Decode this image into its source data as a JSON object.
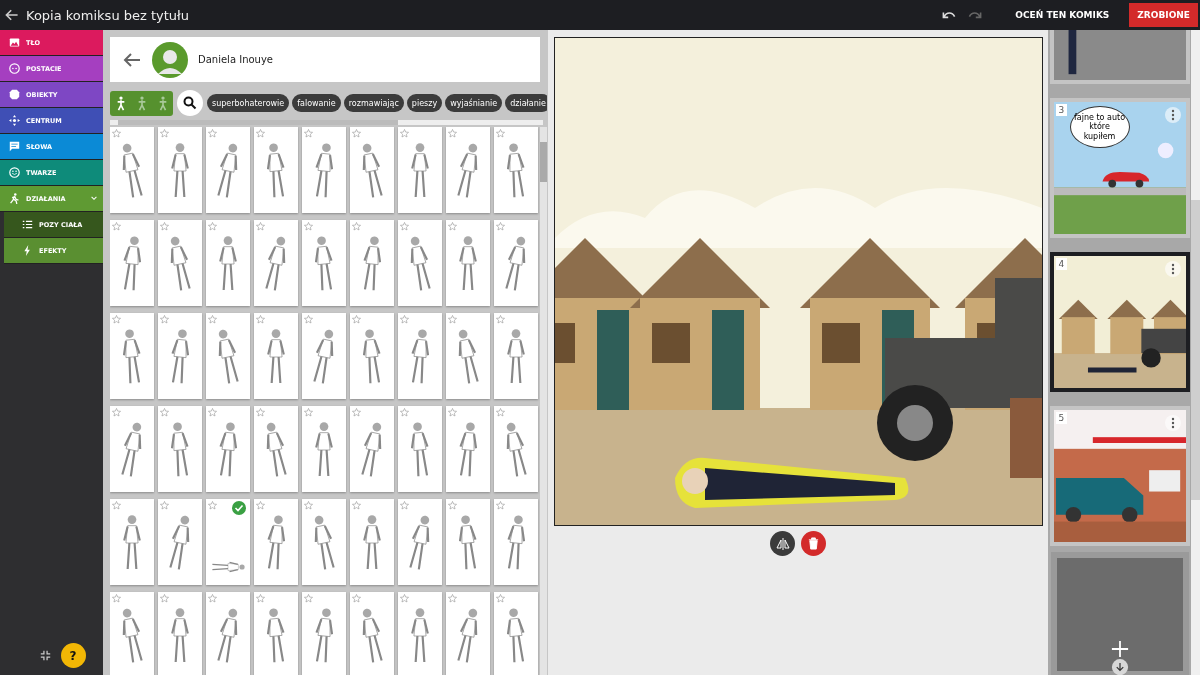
{
  "window": {
    "title": "Kopia komiksu bez tytułu"
  },
  "toolbar": {
    "rate_button": "OCEŃ TEN KOMIKS",
    "done_button": "ZROBIONE"
  },
  "sidebar": {
    "items": [
      {
        "label": "TŁO",
        "kind": "background",
        "color": "#dc1a5e",
        "expanded": false
      },
      {
        "label": "POSTACIE",
        "kind": "characters",
        "color": "#a53fc0",
        "expanded": false
      },
      {
        "label": "OBIEKTY",
        "kind": "objects",
        "color": "#7e47c4",
        "expanded": false
      },
      {
        "label": "CENTRUM",
        "kind": "center",
        "color": "#3f4fb5",
        "expanded": false
      },
      {
        "label": "SŁOWA",
        "kind": "words",
        "color": "#0b8ad6",
        "expanded": false
      },
      {
        "label": "TWARZE",
        "kind": "faces",
        "color": "#0e8b7a",
        "expanded": false
      },
      {
        "label": "DZIAŁANIA",
        "kind": "actions",
        "color": "#5f9a33",
        "expanded": true,
        "children": [
          {
            "label": "POZY CIAŁA",
            "kind": "list",
            "selected": true
          },
          {
            "label": "EFEKTY",
            "kind": "bolt",
            "selected": false
          }
        ]
      }
    ],
    "help_button": "?"
  },
  "character": {
    "name": "Daniela Inouye"
  },
  "pose_views": [
    {
      "selected": true
    },
    {
      "selected": false
    },
    {
      "selected": false
    }
  ],
  "tags": [
    "superbohaterowie",
    "falowanie",
    "rozmawiając",
    "pieszy",
    "wyjaśnianie",
    "działanie"
  ],
  "poses": [
    {
      "selected": false
    },
    {
      "selected": false
    },
    {
      "selected": false
    },
    {
      "selected": false
    },
    {
      "selected": false
    },
    {
      "selected": false
    },
    {
      "selected": false
    },
    {
      "selected": false
    },
    {
      "selected": false
    },
    {
      "selected": false
    },
    {
      "selected": false
    },
    {
      "selected": false
    },
    {
      "selected": false
    },
    {
      "selected": false
    },
    {
      "selected": false
    },
    {
      "selected": false
    },
    {
      "selected": false
    },
    {
      "selected": false
    },
    {
      "selected": false
    },
    {
      "selected": false
    },
    {
      "selected": false
    },
    {
      "selected": false
    },
    {
      "selected": false
    },
    {
      "selected": false
    },
    {
      "selected": false
    },
    {
      "selected": false
    },
    {
      "selected": false
    },
    {
      "selected": false
    },
    {
      "selected": false
    },
    {
      "selected": false
    },
    {
      "selected": false
    },
    {
      "selected": false
    },
    {
      "selected": false
    },
    {
      "selected": false
    },
    {
      "selected": false
    },
    {
      "selected": false
    },
    {
      "selected": false
    },
    {
      "selected": false
    },
    {
      "selected": true
    },
    {
      "selected": false
    },
    {
      "selected": false
    },
    {
      "selected": false
    },
    {
      "selected": false
    },
    {
      "selected": false
    },
    {
      "selected": false
    },
    {
      "selected": false
    },
    {
      "selected": false
    },
    {
      "selected": false
    },
    {
      "selected": false
    },
    {
      "selected": false
    },
    {
      "selected": false
    },
    {
      "selected": false
    },
    {
      "selected": false
    },
    {
      "selected": false
    }
  ],
  "panels": [
    {
      "kind": "street",
      "selected": false
    },
    {
      "number": "3",
      "kind": "rain",
      "selected": false,
      "speech": "fajne to auto które kupiłem"
    },
    {
      "number": "4",
      "kind": "houses",
      "selected": true
    },
    {
      "number": "5",
      "kind": "shop",
      "selected": false
    }
  ]
}
